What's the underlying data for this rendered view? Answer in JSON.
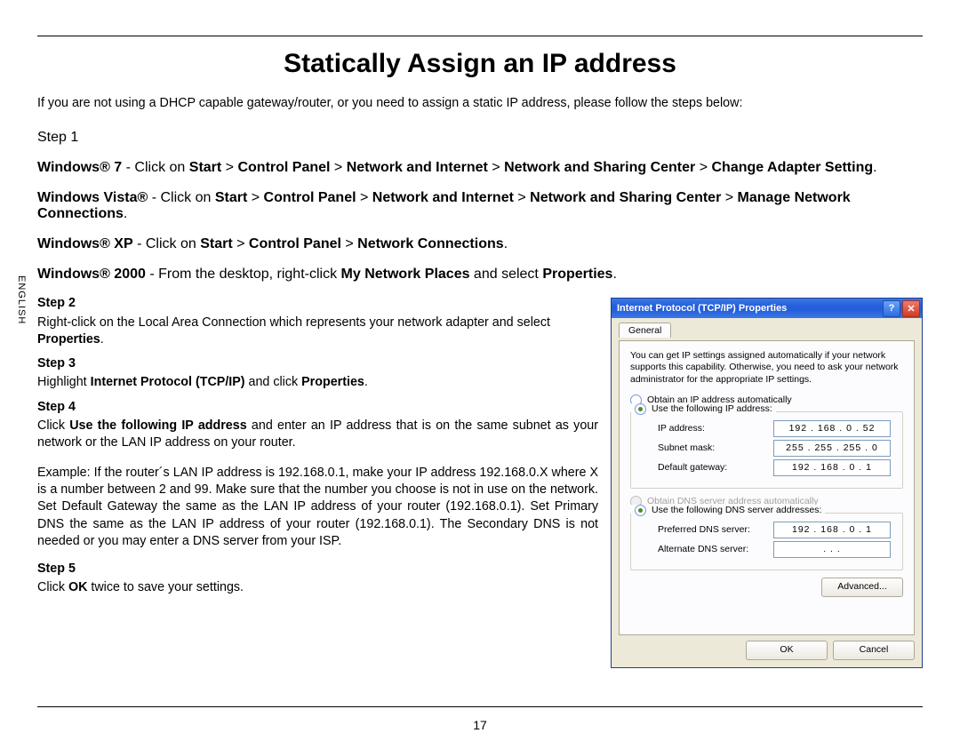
{
  "side_label": "ENGLISH",
  "page_number": "17",
  "title": "Statically Assign an IP address",
  "intro": "If you are not using a DHCP capable gateway/router, or you need to assign a static IP address, please follow the steps below:",
  "steps": {
    "s1_label": "Step 1",
    "s1_win7_a": "Windows® 7",
    "s1_win7_b": " - Click on ",
    "s1_win7_c": "Start",
    "s1_win7_d": "Control Panel",
    "s1_win7_e": "Network and Internet",
    "s1_win7_f": "Network and Sharing Center",
    "s1_win7_g": "Change Adapter Setting",
    "s1_vista_a": "Windows Vista®",
    "s1_vista_g": "Manage Network Connections",
    "s1_xp_a": "Windows® XP",
    "s1_xp_e": "Network Connections",
    "s1_2000_a": "Windows® 2000",
    "s1_2000_b": " - From the desktop, right-click ",
    "s1_2000_c": "My Network Places",
    "s1_2000_d": " and select ",
    "s1_2000_e": "Properties",
    "s2_label": "Step 2",
    "s2_a": "Right-click on the Local Area Connection which represents your network adapter and select ",
    "s2_b": "Properties",
    "s3_label": "Step 3",
    "s3_a": "Highlight ",
    "s3_b": "Internet Protocol (TCP/IP)",
    "s3_c": " and click ",
    "s3_d": "Properties",
    "s4_label": "Step 4",
    "s4_a": "Click ",
    "s4_b": "Use the following IP address",
    "s4_c": " and enter an IP address that is on the same subnet as your network or the LAN IP address on your router.",
    "s4_ex": "Example: If the router´s LAN IP address is 192.168.0.1, make your IP address 192.168.0.X where X is a number between 2 and 99. Make sure that the number you choose is not in use on the network. Set Default Gateway the same as the LAN IP address of your router (192.168.0.1). Set Primary DNS the same as the LAN IP address of your router (192.168.0.1). The Secondary DNS is not needed or you may enter a DNS server from your ISP.",
    "s5_label": "Step 5",
    "s5_a": "Click ",
    "s5_b": "OK",
    "s5_c": " twice to save your settings."
  },
  "dialog": {
    "title": "Internet Protocol (TCP/IP) Properties",
    "help_glyph": "?",
    "close_glyph": "✕",
    "tab": "General",
    "description": "You can get IP settings assigned automatically if your network supports this capability. Otherwise, you need to ask your network administrator for the appropriate IP settings.",
    "radio_obtain_ip": "Obtain an IP address automatically",
    "radio_use_ip": "Use the following IP address:",
    "lbl_ip": "IP address:",
    "lbl_subnet": "Subnet mask:",
    "lbl_gateway": "Default gateway:",
    "val_ip": "192 . 168 .   0  .  52",
    "val_subnet": "255 . 255 . 255 .   0",
    "val_gateway": "192 . 168 .   0  .   1",
    "radio_obtain_dns": "Obtain DNS server address automatically",
    "radio_use_dns": "Use the following DNS server addresses:",
    "lbl_pref_dns": "Preferred DNS server:",
    "lbl_alt_dns": "Alternate DNS server:",
    "val_pref_dns": "192 . 168 .   0  .   1",
    "val_alt_dns": ".        .        .",
    "btn_advanced": "Advanced...",
    "btn_ok": "OK",
    "btn_cancel": "Cancel"
  }
}
